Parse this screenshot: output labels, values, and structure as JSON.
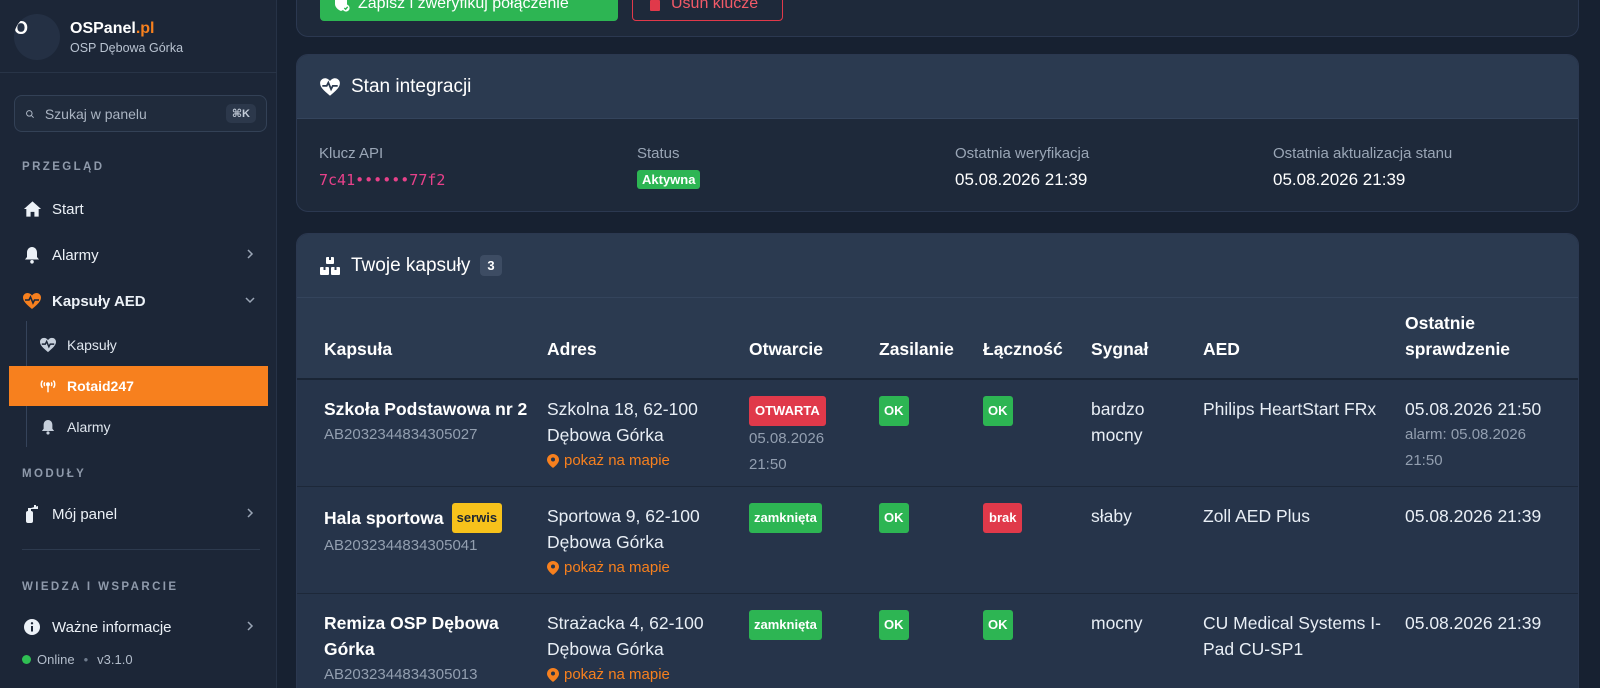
{
  "brand": {
    "name_main": "OSPanel",
    "name_accent": ".pl",
    "subtitle": "OSP Dębowa Górka",
    "logo_mark": "O"
  },
  "search": {
    "placeholder": "Szukaj w panelu",
    "shortcut": "⌘K"
  },
  "sidebar": {
    "section_overview": "PRZEGLĄD",
    "start": "Start",
    "alarms": "Alarmy",
    "aed": "Kapsuły AED",
    "sub_capsules": "Kapsuły",
    "sub_rotaid": "Rotaid247",
    "sub_alarms": "Alarmy",
    "section_modules": "MODUŁY",
    "my_panel": "Mój panel",
    "section_knowledge": "WIEDZA I WSPARCIE",
    "important_info": "Ważne informacje",
    "status_online": "Online",
    "version": "v3.1.0"
  },
  "actions": {
    "save_verify": "Zapisz i zweryfikuj połączenie",
    "delete_keys": "Usuń klucze"
  },
  "integration": {
    "title": "Stan integracji",
    "api_key_label": "Klucz API",
    "api_key_value": "7c41••••••77f2",
    "status_label": "Status",
    "status_value": "Aktywna",
    "last_verify_label": "Ostatnia weryfikacja",
    "last_verify_value": "05.08.2026 21:39",
    "last_update_label": "Ostatnia aktualizacja stanu",
    "last_update_value": "05.08.2026 21:39"
  },
  "capsules": {
    "title": "Twoje kapsuły",
    "count": "3",
    "columns": [
      "Kapsuła",
      "Adres",
      "Otwarcie",
      "Zasilanie",
      "Łączność",
      "Sygnał",
      "AED",
      "Ostatnie sprawdzenie"
    ],
    "rows": [
      {
        "name": "Szkoła Podstawowa nr 2",
        "serial": "AB2032344834305027",
        "badge": "",
        "address": "Szkolna 18, 62-100 Dębowa Górka",
        "map": "pokaż na mapie",
        "opening": "OTWARTA",
        "opening_date": "05.08.2026 21:50",
        "power": "OK",
        "connectivity": "OK",
        "signal": "bardzo mocny",
        "aed": "Philips HeartStart FRx",
        "last_check": "05.08.2026 21:50",
        "last_check_note": "alarm: 05.08.2026 21:50"
      },
      {
        "name": "Hala sportowa",
        "serial": "AB2032344834305041",
        "badge": "serwis",
        "address": "Sportowa 9, 62-100 Dębowa Górka",
        "map": "pokaż na mapie",
        "opening": "zamknięta",
        "opening_date": "",
        "power": "OK",
        "connectivity": "brak",
        "signal": "słaby",
        "aed": "Zoll AED Plus",
        "last_check": "05.08.2026 21:39",
        "last_check_note": ""
      },
      {
        "name": "Remiza OSP Dębowa Górka",
        "serial": "AB2032344834305013",
        "badge": "",
        "address": "Strażacka 4, 62-100 Dębowa Górka",
        "map": "pokaż na mapie",
        "opening": "zamknięta",
        "opening_date": "",
        "power": "OK",
        "connectivity": "OK",
        "signal": "mocny",
        "aed": "CU Medical Systems I-Pad CU-SP1",
        "last_check": "05.08.2026 21:39",
        "last_check_note": ""
      }
    ]
  },
  "colors": {
    "accent": "#f7801e",
    "success": "#2db553",
    "danger": "#e0394a",
    "warning": "#f7c21b"
  }
}
